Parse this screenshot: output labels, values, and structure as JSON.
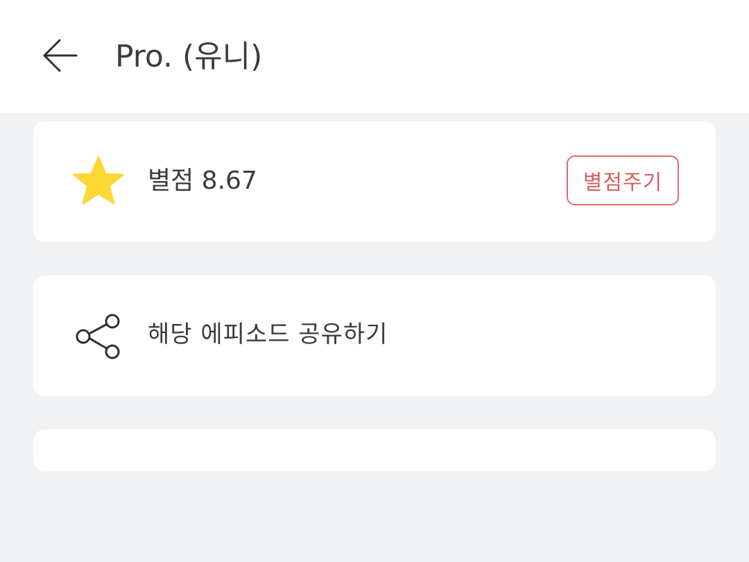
{
  "header": {
    "back_icon": "arrow-left-icon",
    "title": "Pro. (유니)"
  },
  "rating_card": {
    "icon": "star-icon",
    "icon_color": "#fdd835",
    "rating_text": "별점 8.67",
    "rate_button_label": "별점주기",
    "rate_button_color": "#de6a6a"
  },
  "share_card": {
    "icon": "share-icon",
    "label": "해당 에피소드 공유하기"
  },
  "colors": {
    "background": "#f1f2f4",
    "card": "#ffffff",
    "text": "#3a3c40"
  }
}
